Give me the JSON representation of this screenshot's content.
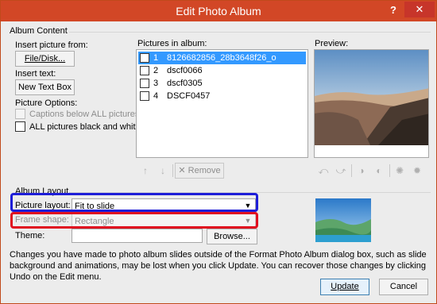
{
  "window": {
    "title": "Edit Photo Album",
    "help": "?",
    "close": "✕"
  },
  "album_content": {
    "group_label": "Album Content",
    "insert_picture_label": "Insert picture from:",
    "file_disk_button": "File/Disk...",
    "insert_text_label": "Insert text:",
    "new_text_box_button": "New Text Box",
    "picture_options_label": "Picture Options:",
    "captions_option": "Captions below ALL pictures",
    "black_white_option": "ALL pictures black and white"
  },
  "pictures": {
    "label": "Pictures in album:",
    "items": [
      {
        "num": "1",
        "name": "8126682856_28b3648f26_o",
        "selected": true
      },
      {
        "num": "2",
        "name": "dscf0066",
        "selected": false
      },
      {
        "num": "3",
        "name": "dscf0305",
        "selected": false
      },
      {
        "num": "4",
        "name": "DSCF0457",
        "selected": false
      }
    ],
    "remove_button": "Remove"
  },
  "preview": {
    "label": "Preview:"
  },
  "album_layout": {
    "group_label": "Album Layout",
    "picture_layout_label": "Picture layout:",
    "picture_layout_value": "Fit to slide",
    "frame_shape_label": "Frame shape:",
    "frame_shape_value": "Rectangle",
    "theme_label": "Theme:",
    "theme_value": "",
    "browse_button": "Browse..."
  },
  "note": "Changes you have made to photo album slides outside of the Format Photo Album dialog box, such as slide background and animations, may be lost when you click Update. You can recover those changes by clicking Undo on the Edit menu.",
  "buttons": {
    "update": "Update",
    "cancel": "Cancel"
  },
  "colors": {
    "titlebar": "#d24726",
    "selection": "#3399ff",
    "highlight_blue": "#1e1ed8",
    "highlight_red": "#e01020"
  }
}
